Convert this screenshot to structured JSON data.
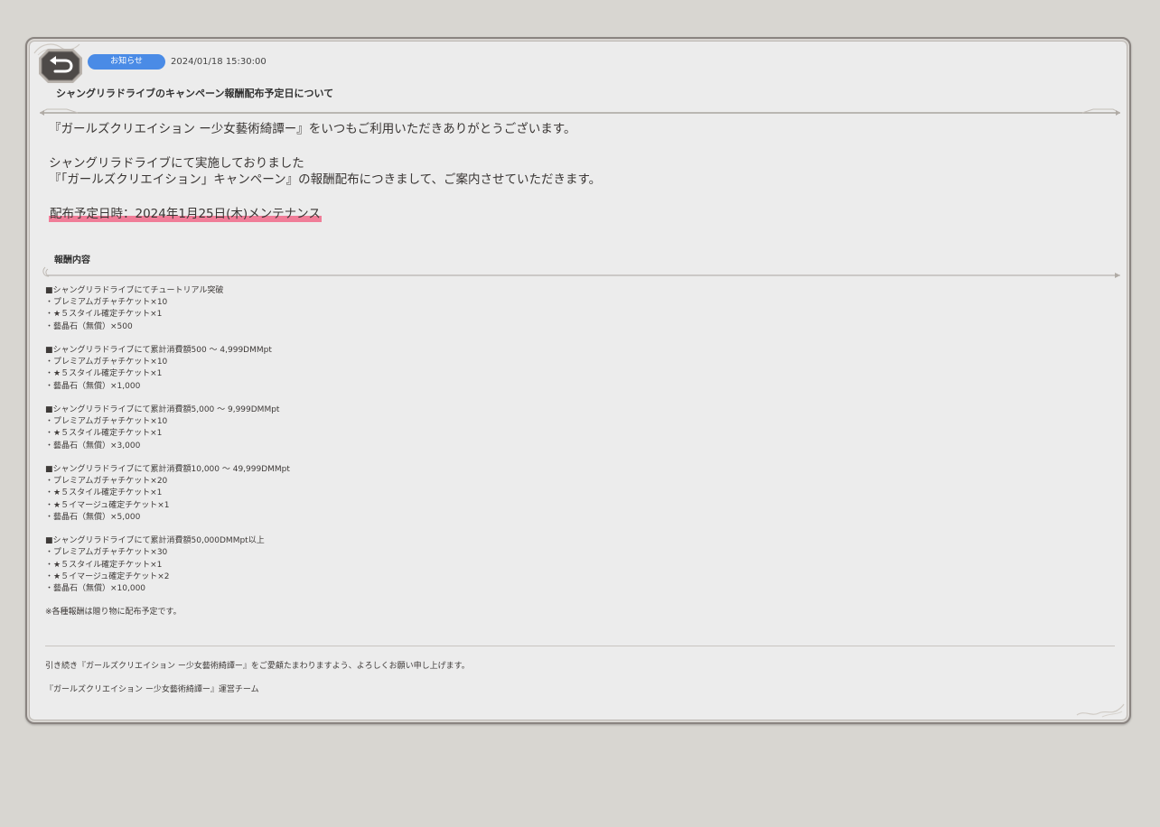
{
  "header": {
    "badge_label": "お知らせ",
    "datetime": "2024/01/18 15:30:00",
    "title": "シャングリラドライブのキャンペーン報酬配布予定日について"
  },
  "intro": {
    "line1": "『ガールズクリエイション ー少女藝術綺譚ー』をいつもご利用いただきありがとうございます。",
    "line2": "シャングリラドライブにて実施しておりました",
    "line3": "『「ガールズクリエイション」キャンペーン』の報酬配布につきまして、ご案内させていただきます。",
    "schedule": "配布予定日時：2024年1月25日(木)メンテナンス"
  },
  "rewards": {
    "section_title": "報酬内容",
    "groups": [
      {
        "heading": "■シャングリラドライブにてチュートリアル突破",
        "items": [
          "・プレミアムガチャチケット×10",
          "・★５スタイル確定チケット×1",
          "・藝晶石（無償）×500"
        ]
      },
      {
        "heading": "■シャングリラドライブにて累計消費額500 〜 4,999DMMpt",
        "items": [
          "・プレミアムガチャチケット×10",
          "・★５スタイル確定チケット×1",
          "・藝晶石（無償）×1,000"
        ]
      },
      {
        "heading": "■シャングリラドライブにて累計消費額5,000 〜 9,999DMMpt",
        "items": [
          "・プレミアムガチャチケット×10",
          "・★５スタイル確定チケット×1",
          "・藝晶石（無償）×3,000"
        ]
      },
      {
        "heading": "■シャングリラドライブにて累計消費額10,000 〜 49,999DMMpt",
        "items": [
          "・プレミアムガチャチケット×20",
          "・★５スタイル確定チケット×1",
          "・★５イマージュ確定チケット×1",
          "・藝晶石（無償）×5,000"
        ]
      },
      {
        "heading": "■シャングリラドライブにて累計消費額50,000DMMpt以上",
        "items": [
          "・プレミアムガチャチケット×30",
          "・★５スタイル確定チケット×1",
          "・★５イマージュ確定チケット×2",
          "・藝晶石（無償）×10,000"
        ]
      }
    ],
    "note": "※各種報酬は贈り物に配布予定です。"
  },
  "footer": {
    "closing": "引き続き『ガールズクリエイション ー少女藝術綺譚ー』をご愛顧たまわりますよう、よろしくお願い申し上げます。",
    "signature": "『ガールズクリエイション ー少女藝術綺譚ー』運営チーム"
  },
  "colors": {
    "badge": "#4a8be6",
    "highlight": "#f07d98",
    "panel": "#ececec",
    "background": "#d8d6d1"
  },
  "icons": {
    "back": "back-arrow-icon"
  }
}
